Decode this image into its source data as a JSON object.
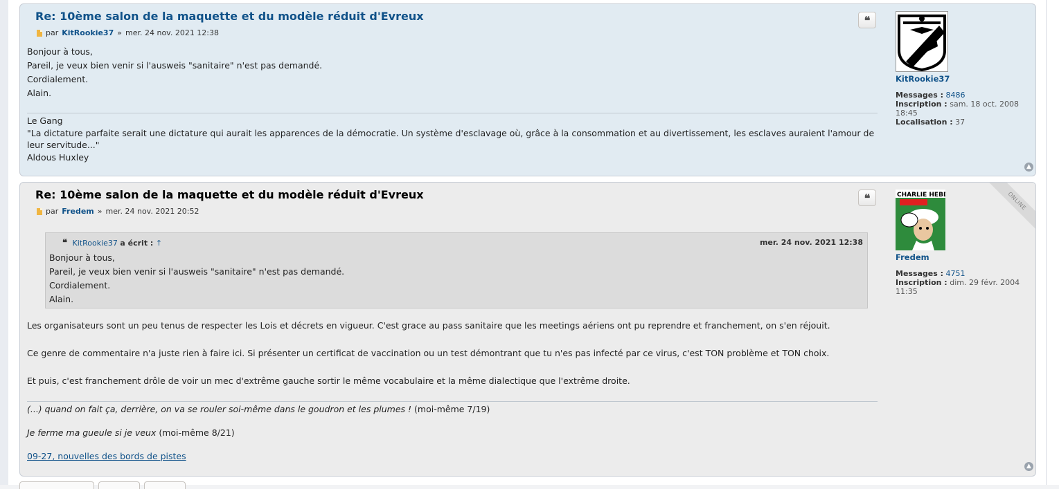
{
  "posts": [
    {
      "title": "Re: 10ème salon de la maquette et du modèle réduit d'Evreux",
      "by": "par",
      "author": "KitRookie37",
      "sep": "»",
      "date": "mer. 24 nov. 2021 12:38",
      "body": [
        "Bonjour à tous,",
        "Pareil, je veux bien venir si l'ausweis \"sanitaire\" n'est pas demandé.",
        "Cordialement.",
        "Alain."
      ],
      "signature": {
        "line1": "Le Gang",
        "line2": "\"La dictature parfaite serait une dictature qui aurait les apparences de la démocratie. Un système d'esclavage où, grâce à la consommation et au divertissement, les esclaves auraient l'amour de",
        "line3": "leur servitude...\"",
        "line4": "Aldous Huxley"
      },
      "profile": {
        "username": "KitRookie37",
        "messages_label": "Messages :",
        "messages": "8486",
        "inscription_label": "Inscription :",
        "inscription": "sam. 18 oct. 2008",
        "inscription_time": "18:45",
        "localisation_label": "Localisation :",
        "localisation": "37"
      }
    },
    {
      "title": "Re: 10ème salon de la maquette et du modèle réduit d'Evreux",
      "by": "par",
      "author": "Fredem",
      "sep": "»",
      "date": "mer. 24 nov. 2021 20:52",
      "online": "ONLINE",
      "quote": {
        "author": "KitRookie37",
        "wrote": "a écrit :",
        "arrow": "↑",
        "date": "mer. 24 nov. 2021 12:38",
        "body": [
          "Bonjour à tous,",
          "Pareil, je veux bien venir si l'ausweis \"sanitaire\" n'est pas demandé.",
          "Cordialement.",
          "Alain."
        ]
      },
      "body": [
        "Les organisateurs sont un peu tenus de respecter les Lois et décrets en vigueur. C'est grace au pass sanitaire que les meetings aériens ont pu reprendre et franchement, on s'en réjouit.",
        "Ce genre de commentaire n'a juste rien à faire ici. Si présenter un certificat de vaccination ou un test démontrant que tu n'es pas infecté par ce virus, c'est TON problème et TON choix.",
        "Et puis, c'est franchement drôle de voir un mec d'extrême gauche sortir le même vocabulaire et la même dialectique que l'extrême droite."
      ],
      "signature": {
        "line1_italic": "(...) quand on fait ça, derrière, on va se rouler soi-même dans le goudron et les plumes !",
        "line1_tail": "(moi-même 7/19)",
        "line2_italic": "Je ferme ma gueule si je veux",
        "line2_tail": "(moi-même 8/21)",
        "link": "09-27, nouvelles des bords de pistes"
      },
      "profile": {
        "username": "Fredem",
        "avatar_text": "CHARLIE HEBDO",
        "messages_label": "Messages :",
        "messages": "4751",
        "inscription_label": "Inscription :",
        "inscription": "dim. 29 févr. 2004",
        "inscription_time": "11:35"
      }
    }
  ],
  "icons": {
    "quote": "quote-icon",
    "top": "arrow-up-icon",
    "post": "file-icon"
  }
}
